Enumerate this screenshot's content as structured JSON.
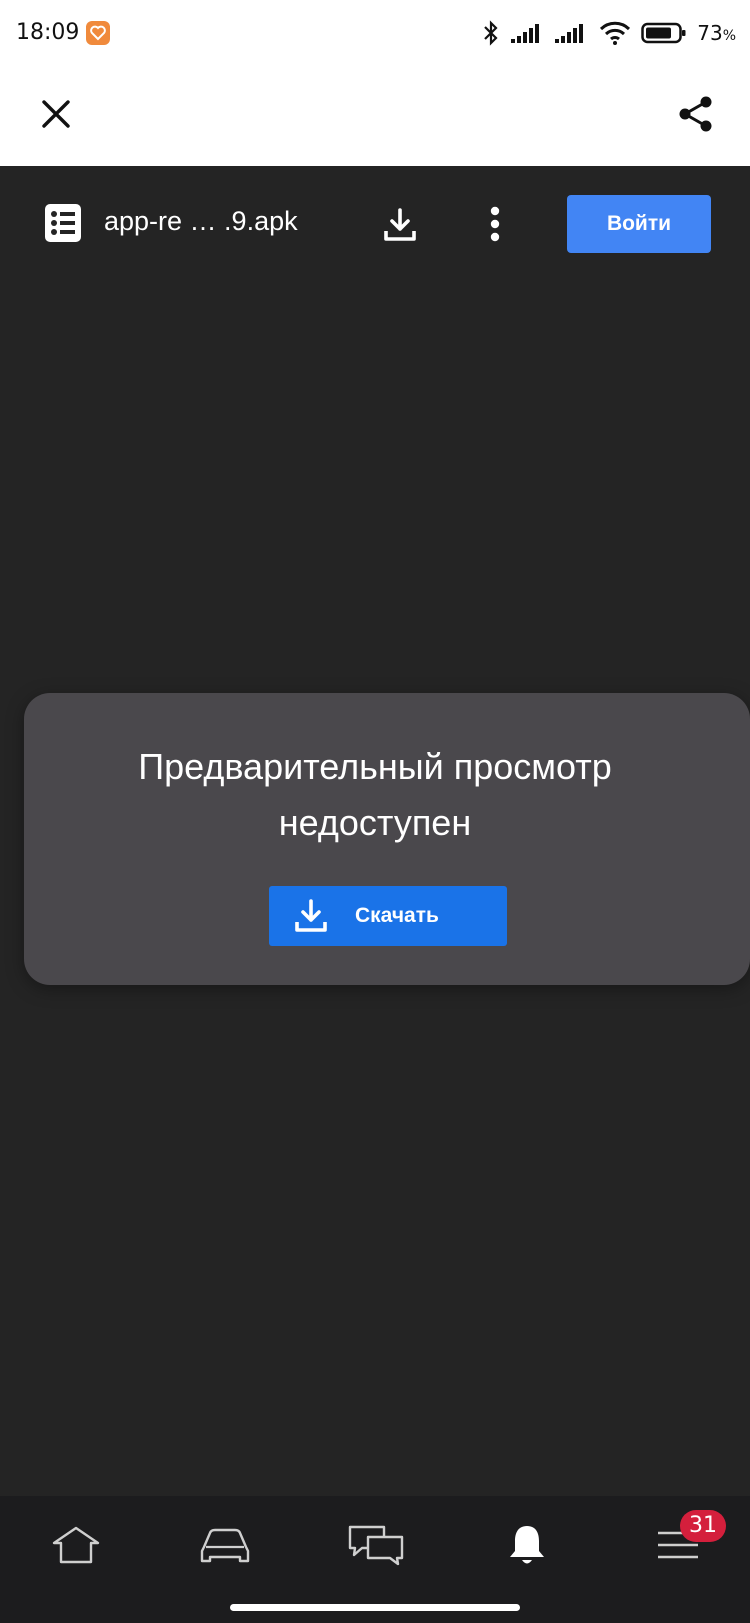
{
  "status_bar": {
    "time": "18:09",
    "battery_percent": "73",
    "battery_suffix": "%",
    "icons": [
      "bluetooth-icon",
      "signal-icon",
      "signal-icon",
      "wifi-icon",
      "battery-icon"
    ]
  },
  "top_bar": {
    "icons": [
      "close-icon",
      "share-icon"
    ]
  },
  "viewer": {
    "file_name": "app-re … .9.apk",
    "login_label": "Войти",
    "icons": [
      "file-list-icon",
      "download-icon",
      "more-vert-icon"
    ]
  },
  "preview": {
    "message_line1": "Предварительный просмотр",
    "message_line2": "недоступен",
    "download_label": "Скачать"
  },
  "bottom_nav": {
    "items": [
      "home-icon",
      "car-icon",
      "chat-icon",
      "bell-icon",
      "menu-icon"
    ],
    "menu_badge": "31"
  },
  "colors": {
    "accent_blue": "#4285f4",
    "download_blue": "#1a73e8",
    "badge_red": "#d41f3c",
    "card": "#4a484c",
    "background": "#242424"
  }
}
